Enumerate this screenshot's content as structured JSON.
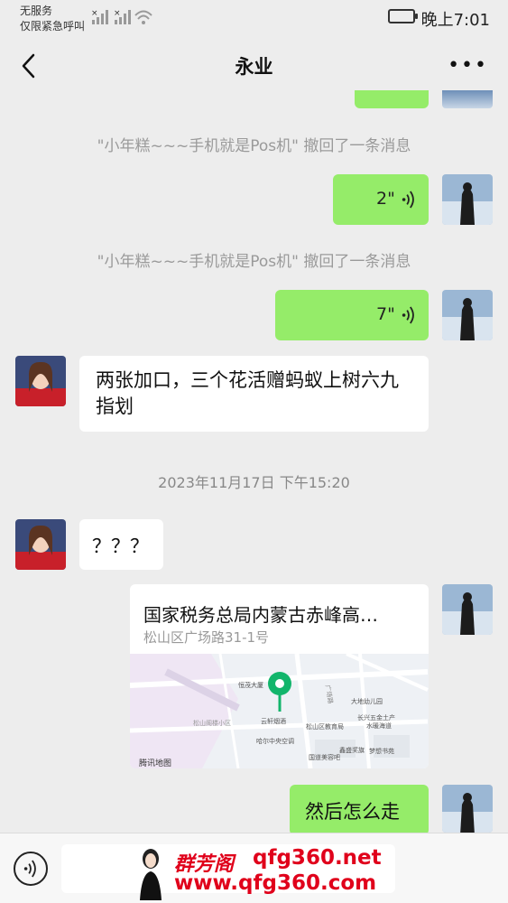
{
  "status_bar": {
    "line1": "无服务",
    "line2": "仅限紧急呼叫",
    "time": "晚上7:01"
  },
  "header": {
    "back_icon": "chevron-left-icon",
    "title": "永业",
    "more_icon": "more-dots-icon"
  },
  "messages": {
    "recall_1": "\"小年糕~~~手机就是Pos机\" 撤回了一条消息",
    "voice_1": "2\"",
    "recall_2": "\"小年糕~~~手机就是Pos机\" 撤回了一条消息",
    "voice_2": "7\"",
    "text_1": "两张加口，三个花活赠蚂蚁上树六九指划",
    "timestamp": "2023年11月17日 下午15:20",
    "text_2": "？？？",
    "location_title": "国家税务总局内蒙古赤峰高…",
    "location_address": "松山区广场路31-1号",
    "map_provider": "腾讯地图",
    "map_labels": [
      "大地幼儿园",
      "恒茂大厦",
      "云轩烟酒",
      "松山区教育局",
      "长兴五金土产",
      "水暖海道",
      "松山阁楼小区",
      "哈尔中央空调",
      "鑫盛奖旗",
      "梦想书苑",
      "国道美容吧",
      "广场路"
    ],
    "text_3": "然后怎么走"
  },
  "watermark": {
    "brand": "群芳阁",
    "domain1": "qfg360.net",
    "domain2": "www.qfg360.com"
  },
  "colors": {
    "background": "#ededed",
    "bubble_self": "#95ec69",
    "bubble_other": "#ffffff",
    "pin": "#12b56b",
    "watermark": "#e0001b"
  }
}
